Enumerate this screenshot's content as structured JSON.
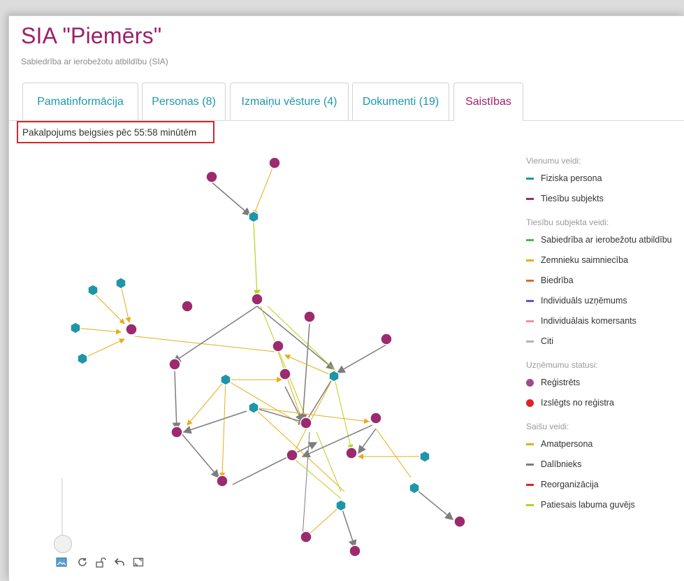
{
  "header": {
    "title": "SIA \"Piemērs\"",
    "subtitle": "Sabiedrība ar ierobežotu atbildību (SIA)"
  },
  "tabs": [
    {
      "label": "Pamatinformācija",
      "active": false
    },
    {
      "label": "Personas (8)",
      "active": false
    },
    {
      "label": "Izmaiņu vēsture (4)",
      "active": false
    },
    {
      "label": "Dokumenti (19)",
      "active": false
    },
    {
      "label": "Saistības",
      "active": true
    }
  ],
  "notice": "Pakalpojums beigsies pēc 55:58 minūtēm",
  "legend": {
    "entity_types_heading": "Vienumu veidi:",
    "entity_types": [
      {
        "label": "Fiziska persona",
        "color": "#1f95a8"
      },
      {
        "label": "Tiesību subjekts",
        "color": "#9b2a6e"
      }
    ],
    "legal_types_heading": "Tiesību subjekta veidi:",
    "legal_types": [
      {
        "label": "Sabiedrība ar ierobežotu atbildību",
        "color": "#3fbf3f"
      },
      {
        "label": "Zemnieku saimniecība",
        "color": "#e6ad14"
      },
      {
        "label": "Biedrība",
        "color": "#e06a2c"
      },
      {
        "label": "Individuāls uzņēmums",
        "color": "#6a52c4"
      },
      {
        "label": "Individuālais komersants",
        "color": "#f4939a"
      },
      {
        "label": "Citi",
        "color": "#b5b5b5"
      }
    ],
    "status_heading": "Uzņēmumu statusi:",
    "statuses": [
      {
        "label": "Reģistrēts",
        "color": "#a04a8a"
      },
      {
        "label": "Izslēgts no reģistra",
        "color": "#e02424"
      }
    ],
    "link_types_heading": "Saišu veidi:",
    "link_types": [
      {
        "label": "Amatpersona",
        "color": "#e6ad14"
      },
      {
        "label": "Dalībnieks",
        "color": "#7d7d7d"
      },
      {
        "label": "Reorganizācija",
        "color": "#e02424"
      },
      {
        "label": "Patiesais labuma guvējs",
        "color": "#b5d418"
      }
    ]
  },
  "controls": {
    "icons": [
      "image-icon",
      "refresh-icon",
      "unlock-icon",
      "undo-icon",
      "fullscreen-icon"
    ]
  }
}
